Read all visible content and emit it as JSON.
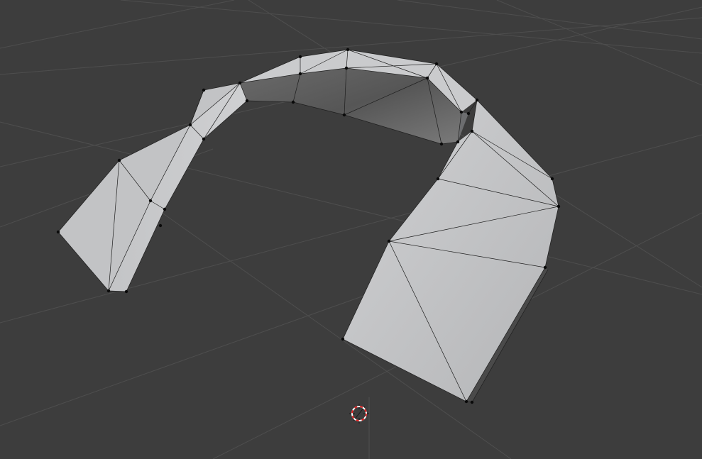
{
  "viewport": {
    "background_color": "#3d3d3d",
    "grid_color": "#4e4e4e",
    "mesh_color": "#c4c5c7",
    "edge_color": "#1e1e1e",
    "vertex_color": "#0a0a0a"
  },
  "icons": {
    "cursor": "3d-cursor-icon"
  }
}
